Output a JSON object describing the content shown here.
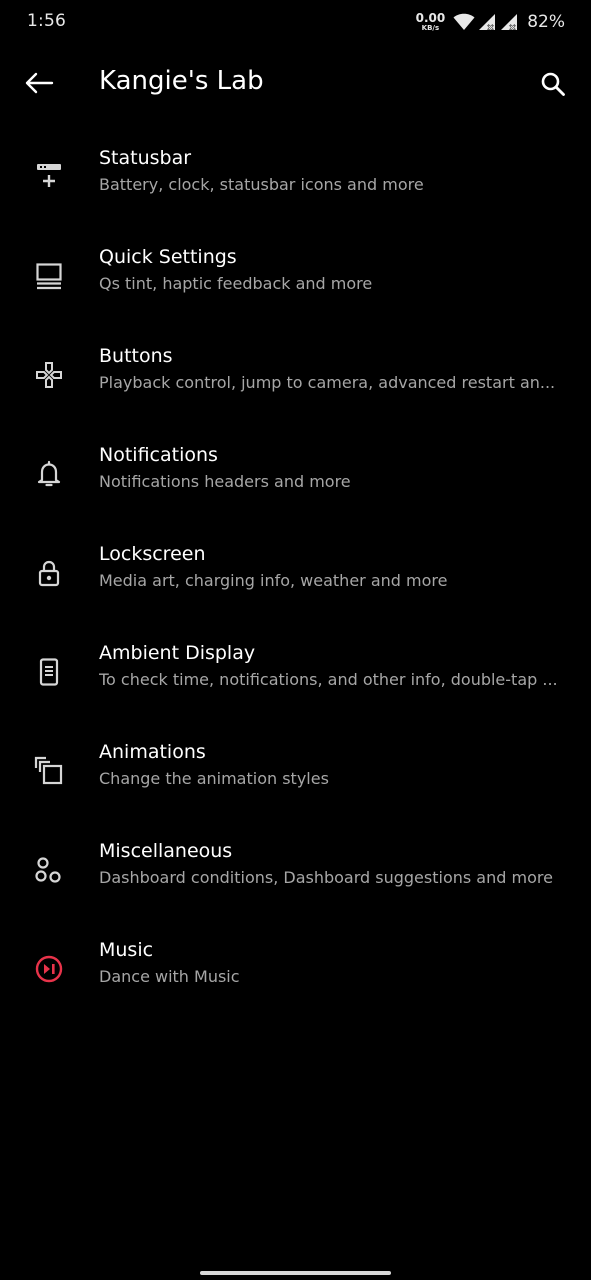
{
  "status_bar": {
    "time": "1:56",
    "net_speed_value": "0.00",
    "net_speed_unit": "KB/s",
    "battery": "82%",
    "icons": [
      "wifi-icon",
      "cell-signal-icon",
      "cell-signal-icon",
      "battery-text"
    ]
  },
  "app_bar": {
    "title": "Kangie's Lab",
    "back_icon": "arrow-back-icon",
    "search_icon": "search-icon"
  },
  "colors": {
    "background": "#000000",
    "title_text": "#ffffff",
    "summary_text": "#a6a6a6",
    "icon": "#d6d6d6",
    "music_accent": "#e8334a"
  },
  "items": [
    {
      "title": "Statusbar",
      "summary": "Battery, clock, statusbar icons and more",
      "icon": "statusbar-icon"
    },
    {
      "title": "Quick Settings",
      "summary": "Qs tint, haptic feedback and more",
      "icon": "quick-settings-icon"
    },
    {
      "title": "Buttons",
      "summary": "Playback control, jump to camera, advanced restart an...",
      "icon": "gamepad-icon"
    },
    {
      "title": "Notifications",
      "summary": "Notifications headers and more",
      "icon": "bell-icon"
    },
    {
      "title": "Lockscreen",
      "summary": "Media art, charging info, weather and more",
      "icon": "lock-icon"
    },
    {
      "title": "Ambient Display",
      "summary": "To check time, notifications, and other info, double-tap ...",
      "icon": "ambient-display-icon"
    },
    {
      "title": "Animations",
      "summary": "Change the animation styles",
      "icon": "animations-icon"
    },
    {
      "title": "Miscellaneous",
      "summary": "Dashboard conditions, Dashboard suggestions and more",
      "icon": "misc-circles-icon"
    },
    {
      "title": "Music",
      "summary": "Dance with Music",
      "icon": "music-play-pause-icon"
    }
  ]
}
